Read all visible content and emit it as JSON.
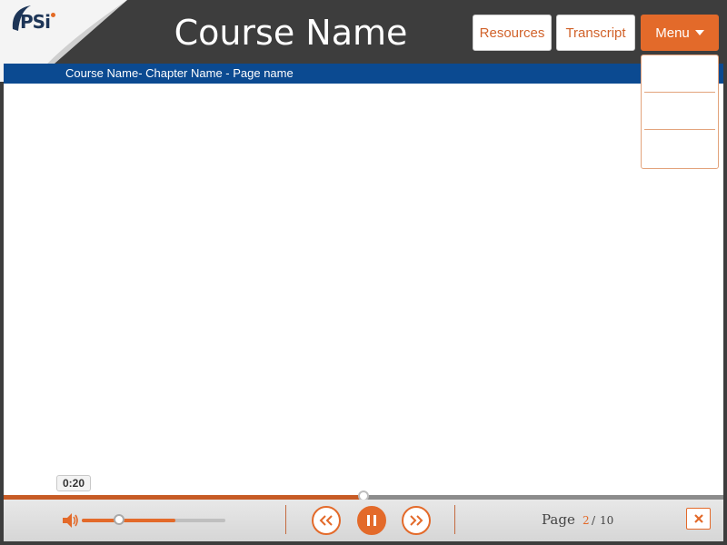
{
  "header": {
    "title": "Course Name",
    "logo_text": "PSi",
    "buttons": {
      "resources": "Resources",
      "transcript": "Transcript",
      "menu": "Menu"
    },
    "menu_items": [
      "",
      "",
      ""
    ]
  },
  "breadcrumb": "Course Name- Chapter Name - Page name",
  "player": {
    "time_tooltip": "0:20",
    "progress_percent": 50,
    "volume_percent": 65,
    "page_label": "Page",
    "page_current": "2",
    "page_separator": "/",
    "page_total": "10"
  },
  "icons": {
    "volume": "speaker-icon",
    "rewind": "rewind-icon",
    "pause": "pause-icon",
    "forward": "fast-forward-icon",
    "close": "close-icon"
  },
  "colors": {
    "accent": "#e36a2a",
    "breadcrumb_bar": "#0b4a91",
    "topbar": "#3d3d3d"
  }
}
